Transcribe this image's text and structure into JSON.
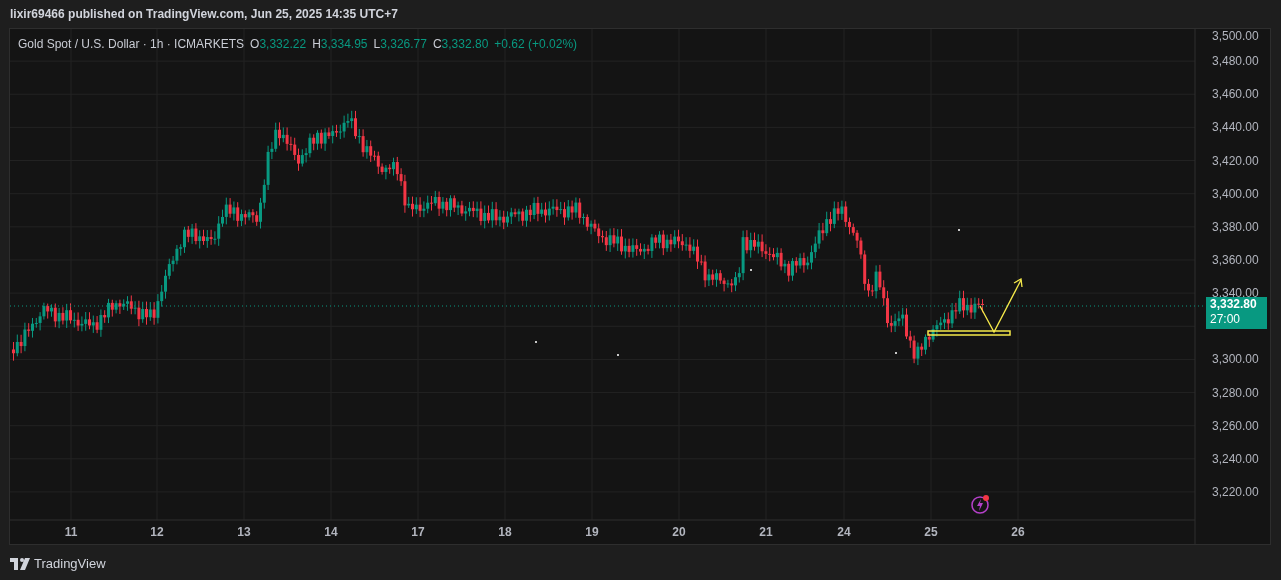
{
  "header": {
    "publisher": "lixir69466 published on TradingView.com, Jun 25, 2025 14:35 UTC+7"
  },
  "legend": {
    "symbol": "Gold Spot / U.S. Dollar · 1h · ICMARKETS",
    "ohlc": [
      {
        "letter": "O",
        "value": "3,332.22"
      },
      {
        "letter": "H",
        "value": "3,334.95"
      },
      {
        "letter": "L",
        "value": "3,326.77"
      },
      {
        "letter": "C",
        "value": "3,332.80"
      }
    ],
    "change": "+0.62 (+0.02%)"
  },
  "price_axis": {
    "upper_labels": [
      "3,500.00",
      "3,480.00",
      "3,460.00",
      "3,440.00",
      "3,420.00",
      "3,400.00",
      "3,380.00",
      "3,360.00",
      "3,340.00"
    ],
    "lower_labels": [
      "3,300.00",
      "3,280.00",
      "3,260.00",
      "3,240.00",
      "3,220.00"
    ]
  },
  "last_price": {
    "price": "3,332.80",
    "countdown": "27:00"
  },
  "time_axis": {
    "labels": [
      "11",
      "12",
      "13",
      "14",
      "17",
      "18",
      "19",
      "20",
      "21",
      "24",
      "25",
      "26"
    ]
  },
  "footer": {
    "brand": "TradingView"
  }
}
